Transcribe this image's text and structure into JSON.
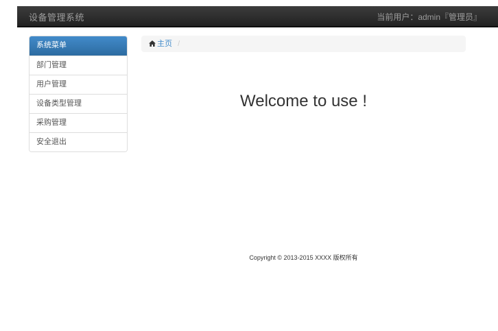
{
  "navbar": {
    "brand": "设备管理系统",
    "user_info": "当前用户：admin『管理员』"
  },
  "sidebar": {
    "header": "系统菜单",
    "items": [
      {
        "label": "部门管理"
      },
      {
        "label": "用户管理"
      },
      {
        "label": "设备类型管理"
      },
      {
        "label": "采购管理"
      },
      {
        "label": "安全退出"
      }
    ]
  },
  "breadcrumb": {
    "home_label": "主页",
    "home_icon": "home-icon",
    "separator": "/"
  },
  "main": {
    "welcome": "Welcome to use !"
  },
  "footer": {
    "copyright": "Copyright © 2013-2015 XXXX 版权所有"
  },
  "colors": {
    "navbar_bg": "#222222",
    "sidebar_active": "#428bca",
    "link": "#428bca"
  }
}
